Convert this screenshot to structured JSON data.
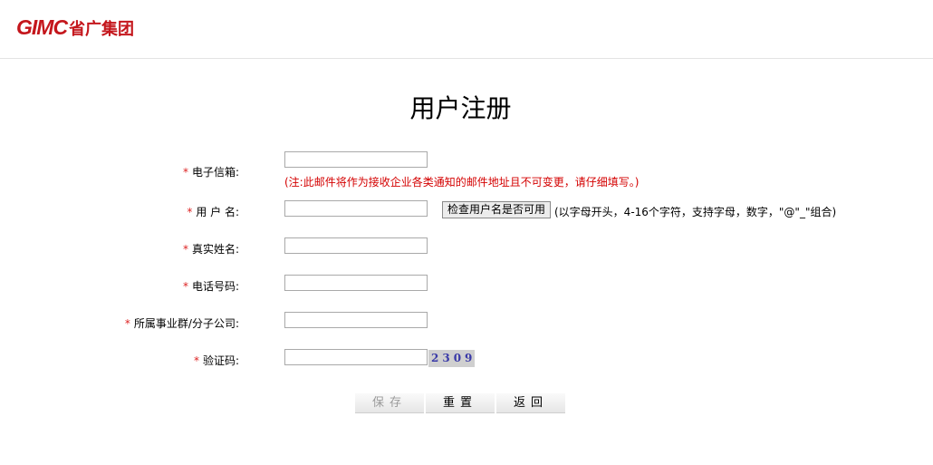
{
  "header": {
    "logo_mark": "GIMC",
    "logo_cn": "省广集团"
  },
  "page": {
    "title": "用户注册"
  },
  "form": {
    "required_mark": "*",
    "fields": {
      "email": {
        "label": "电子信箱:",
        "value": "",
        "note": "(注:此邮件将作为接收企业各类通知的邮件地址且不可变更，请仔细填写。)"
      },
      "username": {
        "label": "用 户 名:",
        "value": "",
        "check_label": "检查用户名是否可用",
        "hint": "(以字母开头，4-16个字符，支持字母，数字，\"@\"_\"组合)"
      },
      "realname": {
        "label": "真实姓名:",
        "value": ""
      },
      "phone": {
        "label": "电话号码:",
        "value": ""
      },
      "company": {
        "label": "所属事业群/分子公司:",
        "value": ""
      },
      "captcha": {
        "label": "验证码:",
        "value": "",
        "image_text": "2309"
      }
    }
  },
  "buttons": {
    "save": "保存",
    "reset": "重置",
    "back": "返回"
  },
  "colors": {
    "brand": "#c4161c",
    "required": "#dd2222",
    "note": "#d40000"
  }
}
